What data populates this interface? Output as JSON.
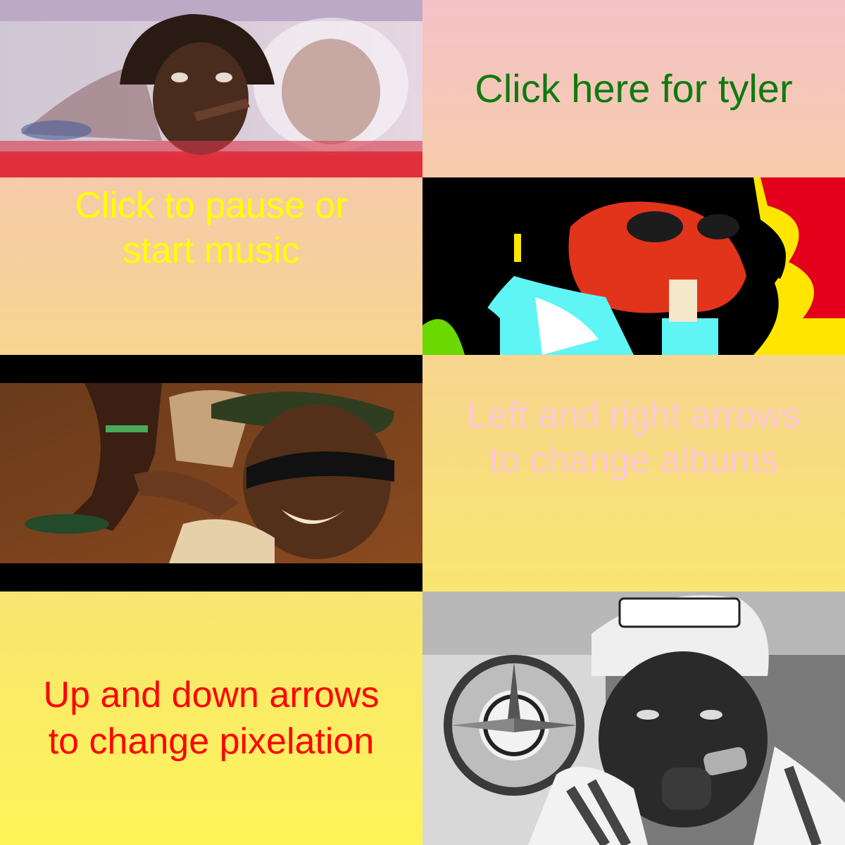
{
  "captions": {
    "tyler": "Click here for tyler",
    "music": "Click to pause or\nstart music",
    "albums": "Left and right arrows\nto change albums",
    "pixelation": "Up and down arrows\nto change pixelation"
  },
  "colors": {
    "tyler": "#0f7a0f",
    "music": "#ffff00",
    "albums": "#ffc8d6",
    "pixelation": "#ff0000"
  },
  "photos": {
    "top_left": "album-photo-pink-overlay",
    "middle_right": "album-photo-posterized",
    "left_middle": "album-photo-orange-tint",
    "bottom_right": "album-photo-grayscale"
  }
}
